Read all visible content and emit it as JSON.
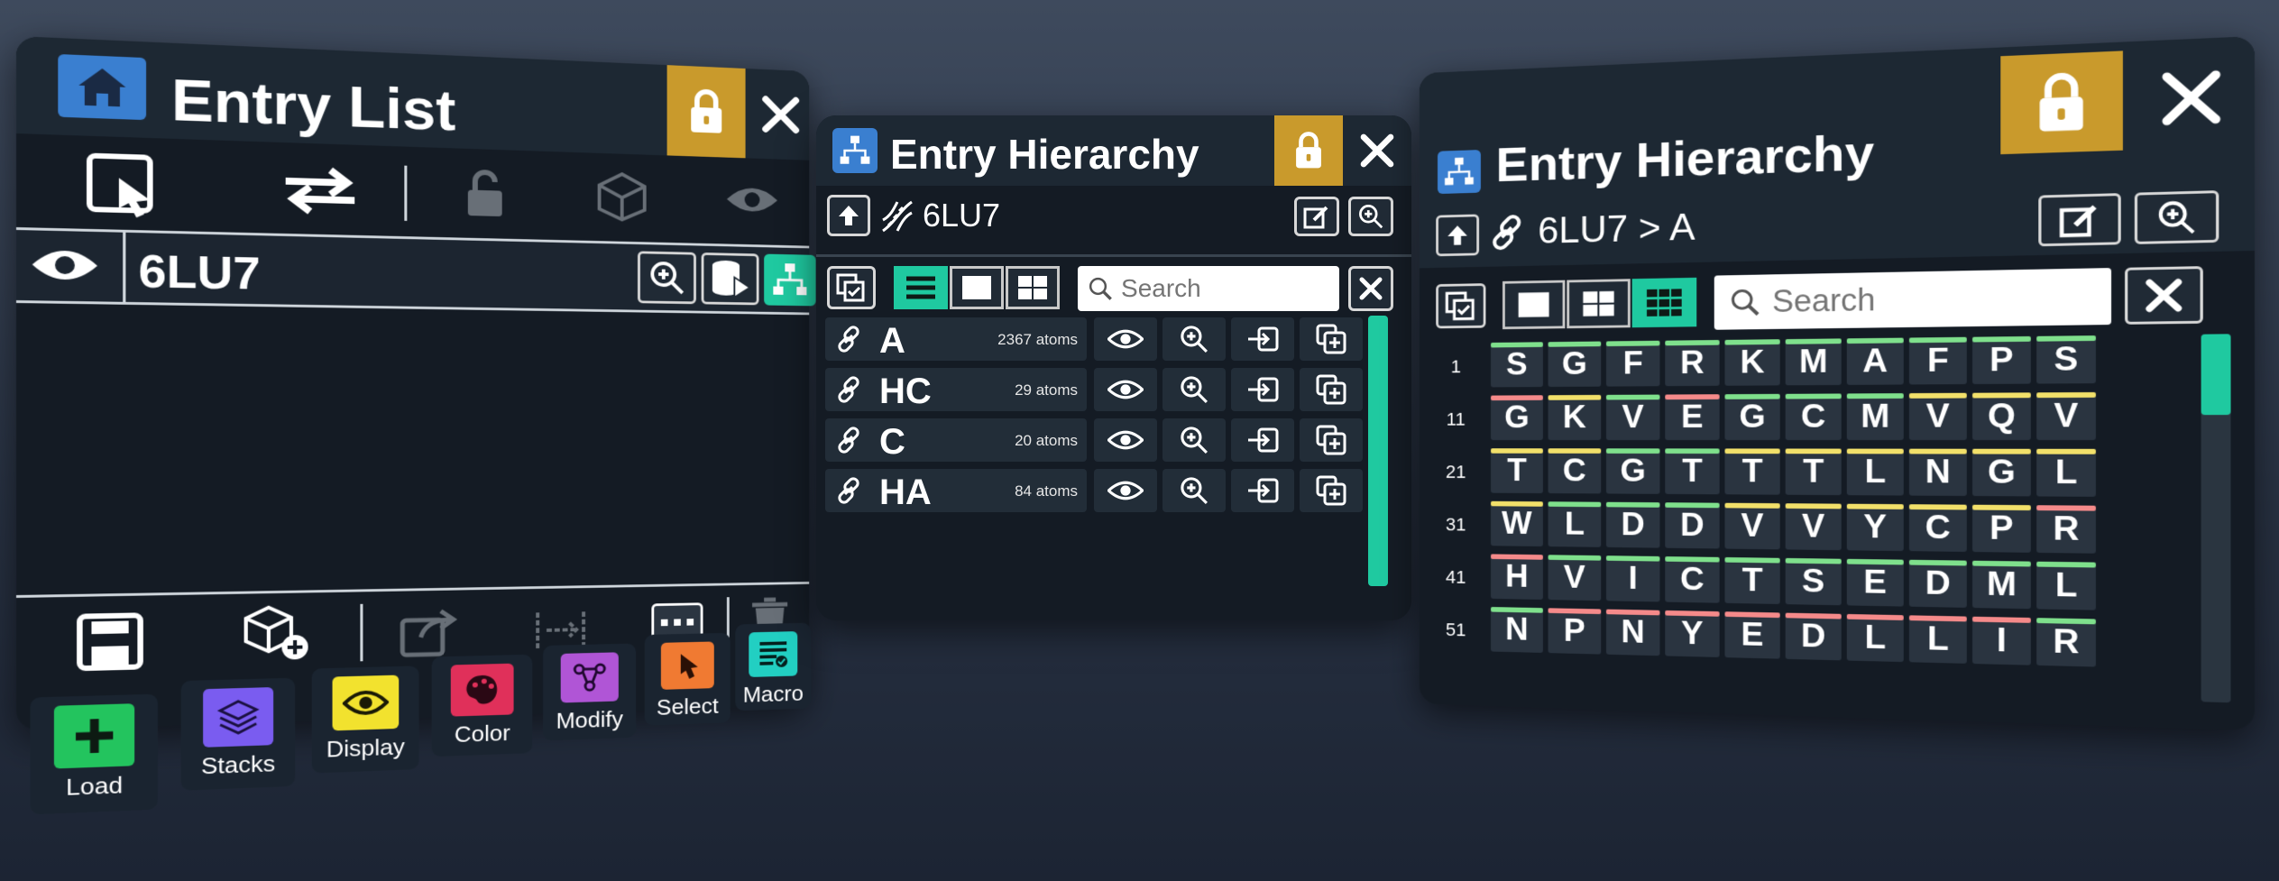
{
  "colors": {
    "accent": "#1fc9a0",
    "lock": "#c99a2c",
    "panel": "#141b24",
    "titlebar": "#1d2833",
    "cell": "#2a3440",
    "green": "#7fe08c",
    "yellow": "#f2e06a",
    "red": "#f58a8a"
  },
  "entry_list": {
    "title": "Entry List",
    "entries": [
      {
        "name": "6LU7"
      }
    ],
    "dock": [
      {
        "label": "Load",
        "icon": "plus-icon",
        "color": "#23c45e"
      },
      {
        "label": "Stacks",
        "icon": "stacks-icon",
        "color": "#7a5cf0"
      },
      {
        "label": "Display",
        "icon": "eye-icon",
        "color": "#f2e22e"
      },
      {
        "label": "Color",
        "icon": "palette-icon",
        "color": "#e0305a"
      },
      {
        "label": "Modify",
        "icon": "molecule-icon",
        "color": "#b055d6"
      },
      {
        "label": "Select",
        "icon": "select-hand-icon",
        "color": "#f07a32"
      },
      {
        "label": "Macro",
        "icon": "macro-list-icon",
        "color": "#22cfc2"
      }
    ]
  },
  "hierarchy_small": {
    "title": "Entry Hierarchy",
    "path": "6LU7",
    "search_placeholder": "Search",
    "chains": [
      {
        "name": "A",
        "atoms": "2367 atoms"
      },
      {
        "name": "HC",
        "atoms": "29 atoms"
      },
      {
        "name": "C",
        "atoms": "20 atoms"
      },
      {
        "name": "HA",
        "atoms": "84 atoms"
      }
    ]
  },
  "hierarchy_large": {
    "title": "Entry Hierarchy",
    "path": "6LU7 > A",
    "search_placeholder": "Search",
    "row_numbers": [
      "1",
      "11",
      "21",
      "31",
      "41",
      "51"
    ],
    "rows": [
      [
        {
          "r": "S",
          "c": "g"
        },
        {
          "r": "G",
          "c": "g"
        },
        {
          "r": "F",
          "c": "g"
        },
        {
          "r": "R",
          "c": "g"
        },
        {
          "r": "K",
          "c": "g"
        },
        {
          "r": "M",
          "c": "g"
        },
        {
          "r": "A",
          "c": "g"
        },
        {
          "r": "F",
          "c": "g"
        },
        {
          "r": "P",
          "c": "g"
        },
        {
          "r": "S",
          "c": "g"
        }
      ],
      [
        {
          "r": "G",
          "c": "r"
        },
        {
          "r": "K",
          "c": "y"
        },
        {
          "r": "V",
          "c": "g"
        },
        {
          "r": "E",
          "c": "r"
        },
        {
          "r": "G",
          "c": "g"
        },
        {
          "r": "C",
          "c": "g"
        },
        {
          "r": "M",
          "c": "g"
        },
        {
          "r": "V",
          "c": "y"
        },
        {
          "r": "Q",
          "c": "y"
        },
        {
          "r": "V",
          "c": "y"
        }
      ],
      [
        {
          "r": "T",
          "c": "y"
        },
        {
          "r": "C",
          "c": "y"
        },
        {
          "r": "G",
          "c": "g"
        },
        {
          "r": "T",
          "c": "g"
        },
        {
          "r": "T",
          "c": "y"
        },
        {
          "r": "T",
          "c": "y"
        },
        {
          "r": "L",
          "c": "y"
        },
        {
          "r": "N",
          "c": "y"
        },
        {
          "r": "G",
          "c": "y"
        },
        {
          "r": "L",
          "c": "y"
        }
      ],
      [
        {
          "r": "W",
          "c": "y"
        },
        {
          "r": "L",
          "c": "g"
        },
        {
          "r": "D",
          "c": "g"
        },
        {
          "r": "D",
          "c": "g"
        },
        {
          "r": "V",
          "c": "y"
        },
        {
          "r": "V",
          "c": "y"
        },
        {
          "r": "Y",
          "c": "y"
        },
        {
          "r": "C",
          "c": "y"
        },
        {
          "r": "P",
          "c": "y"
        },
        {
          "r": "R",
          "c": "r"
        }
      ],
      [
        {
          "r": "H",
          "c": "r"
        },
        {
          "r": "V",
          "c": "g"
        },
        {
          "r": "I",
          "c": "g"
        },
        {
          "r": "C",
          "c": "g"
        },
        {
          "r": "T",
          "c": "g"
        },
        {
          "r": "S",
          "c": "g"
        },
        {
          "r": "E",
          "c": "g"
        },
        {
          "r": "D",
          "c": "g"
        },
        {
          "r": "M",
          "c": "g"
        },
        {
          "r": "L",
          "c": "g"
        }
      ],
      [
        {
          "r": "N",
          "c": "g"
        },
        {
          "r": "P",
          "c": "r"
        },
        {
          "r": "N",
          "c": "r"
        },
        {
          "r": "Y",
          "c": "r"
        },
        {
          "r": "E",
          "c": "r"
        },
        {
          "r": "D",
          "c": "r"
        },
        {
          "r": "L",
          "c": "r"
        },
        {
          "r": "L",
          "c": "r"
        },
        {
          "r": "I",
          "c": "r"
        },
        {
          "r": "R",
          "c": "g"
        }
      ]
    ]
  }
}
